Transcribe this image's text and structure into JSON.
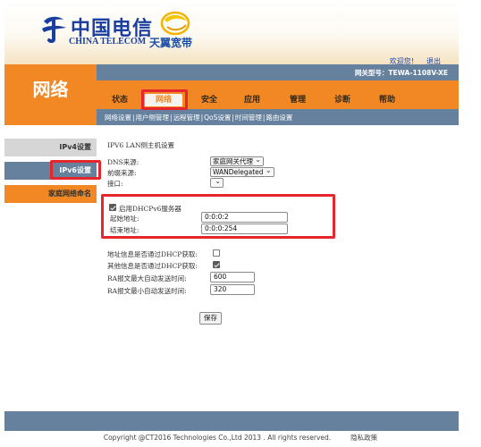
{
  "header": {
    "brand_cn": "中国电信",
    "brand_en": "CHINA TELECOM",
    "sub_brand": "天翼宽带",
    "welcome": "欢迎您!",
    "logout": "退出",
    "model": "网关型号：TEWA-1108V-XE"
  },
  "section_title": "网络",
  "tabs": [
    {
      "label": "状态"
    },
    {
      "label": "网络"
    },
    {
      "label": "安全"
    },
    {
      "label": "应用"
    },
    {
      "label": "管理"
    },
    {
      "label": "诊断"
    },
    {
      "label": "帮助"
    }
  ],
  "subnav": [
    {
      "label": "网络设置"
    },
    {
      "label": "用户侧管理"
    },
    {
      "label": "远程管理"
    },
    {
      "label": "QoS设置"
    },
    {
      "label": "时间管理"
    },
    {
      "label": "路由设置"
    }
  ],
  "sidebar": {
    "items": [
      {
        "label": "IPv4设置"
      },
      {
        "label": "IPv6设置"
      },
      {
        "label": "家庭网络命名"
      }
    ]
  },
  "main": {
    "title": "IPV6 LAN侧主机设置",
    "dns_label": "DNS来源:",
    "dns_value": "家庭网关代理",
    "prefix_label": "前缀来源:",
    "prefix_value": "WANDelegated",
    "interface_label": "接口:",
    "interface_value": "",
    "dhcp_enable_label": "启用DHCPv6服务器",
    "start_label": "起始地址:",
    "start_value": "0:0:0:2",
    "end_label": "结束地址:",
    "end_value": "0:0:0:254",
    "addr_dhcp_label": "地址信息是否通过DHCP获取:",
    "other_dhcp_label": "其他信息是否通过DHCP获取:",
    "ra_max_label": "RA报文最大自动发送时间:",
    "ra_max_value": "600",
    "ra_min_label": "RA报文最小自动发送时间:",
    "ra_min_value": "320",
    "save_label": "保存"
  },
  "states": {
    "dhcp_enabled": true,
    "addr_via_dhcp": false,
    "other_via_dhcp": true
  },
  "footer": {
    "copyright": "Copyright @CT2016 Technologies Co.,Ltd 2013 . All rights reserved.",
    "privacy": "隐私政策"
  },
  "colors": {
    "orange": "#f18824",
    "steel_blue": "#66819d",
    "highlight_red": "#e5262c",
    "brand_blue": "#1b3f9e"
  }
}
